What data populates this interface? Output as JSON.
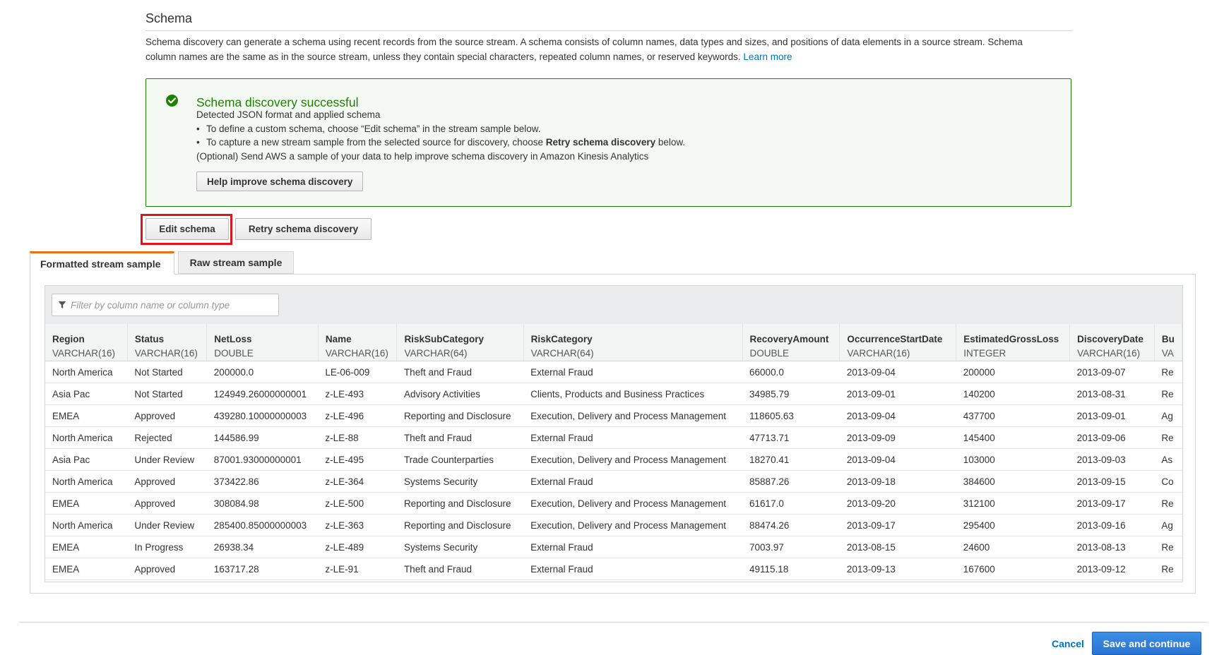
{
  "schema": {
    "title": "Schema",
    "description_1": "Schema discovery can generate a schema using recent records from the source stream. A schema consists of column names, data types and sizes, and positions of data elements in a source stream. Schema",
    "description_2": "column names are the same as in the source stream, unless they contain special characters, repeated column names, or reserved keywords.",
    "learn_more": "Learn more"
  },
  "success": {
    "title": "Schema discovery successful",
    "detected": "Detected JSON format and applied schema",
    "bullet_1": "To define a custom schema, choose “Edit schema” in the stream sample below.",
    "bullet_2_prefix": "To capture a new stream sample from the selected source for discovery, choose",
    "bullet_2_bold": "Retry schema discovery",
    "bullet_2_suffix": "below.",
    "optional": "(Optional) Send AWS a sample of your data to help improve schema discovery in Amazon Kinesis Analytics",
    "help_button": "Help improve schema discovery"
  },
  "actions": {
    "edit_schema": "Edit schema",
    "retry": "Retry schema discovery"
  },
  "tabs": [
    {
      "label": "Formatted stream sample",
      "active": true
    },
    {
      "label": "Raw stream sample",
      "active": false
    }
  ],
  "filter": {
    "placeholder": "Filter by column name or column type"
  },
  "columns": [
    {
      "name": "Region",
      "type": "VARCHAR(16)"
    },
    {
      "name": "Status",
      "type": "VARCHAR(16)"
    },
    {
      "name": "NetLoss",
      "type": "DOUBLE"
    },
    {
      "name": "Name",
      "type": "VARCHAR(16)"
    },
    {
      "name": "RiskSubCategory",
      "type": "VARCHAR(64)"
    },
    {
      "name": "RiskCategory",
      "type": "VARCHAR(64)"
    },
    {
      "name": "RecoveryAmount",
      "type": "DOUBLE"
    },
    {
      "name": "OccurrenceStartDate",
      "type": "VARCHAR(16)"
    },
    {
      "name": "EstimatedGrossLoss",
      "type": "INTEGER"
    },
    {
      "name": "DiscoveryDate",
      "type": "VARCHAR(16)"
    },
    {
      "name": "Bu",
      "type": "VA"
    }
  ],
  "rows": [
    [
      "North America",
      "Not Started",
      "200000.0",
      "LE-06-009",
      "Theft and Fraud",
      "External Fraud",
      "66000.0",
      "2013-09-04",
      "200000",
      "2013-09-07",
      "Re"
    ],
    [
      "Asia Pac",
      "Not Started",
      "124949.26000000001",
      "z-LE-493",
      "Advisory Activities",
      "Clients, Products and Business Practices",
      "34985.79",
      "2013-09-01",
      "140200",
      "2013-08-31",
      "Re"
    ],
    [
      "EMEA",
      "Approved",
      "439280.10000000003",
      "z-LE-496",
      "Reporting and Disclosure",
      "Execution, Delivery and Process Management",
      "118605.63",
      "2013-09-04",
      "437700",
      "2013-09-01",
      "Ag"
    ],
    [
      "North America",
      "Rejected",
      "144586.99",
      "z-LE-88",
      "Theft and Fraud",
      "External Fraud",
      "47713.71",
      "2013-09-09",
      "145400",
      "2013-09-06",
      "Re"
    ],
    [
      "Asia Pac",
      "Under Review",
      "87001.93000000001",
      "z-LE-495",
      "Trade Counterparties",
      "Execution, Delivery and Process Management",
      "18270.41",
      "2013-09-04",
      "103000",
      "2013-09-03",
      "As"
    ],
    [
      "North America",
      "Approved",
      "373422.86",
      "z-LE-364",
      "Systems Security",
      "External Fraud",
      "85887.26",
      "2013-09-18",
      "384600",
      "2013-09-15",
      "Co"
    ],
    [
      "EMEA",
      "Approved",
      "308084.98",
      "z-LE-500",
      "Reporting and Disclosure",
      "Execution, Delivery and Process Management",
      "61617.0",
      "2013-09-20",
      "312100",
      "2013-09-17",
      "Re"
    ],
    [
      "North America",
      "Under Review",
      "285400.85000000003",
      "z-LE-363",
      "Reporting and Disclosure",
      "Execution, Delivery and Process Management",
      "88474.26",
      "2013-09-17",
      "295400",
      "2013-09-16",
      "Ag"
    ],
    [
      "EMEA",
      "In Progress",
      "26938.34",
      "z-LE-489",
      "Systems Security",
      "External Fraud",
      "7003.97",
      "2013-08-15",
      "24600",
      "2013-08-13",
      "Re"
    ],
    [
      "EMEA",
      "Approved",
      "163717.28",
      "z-LE-91",
      "Theft and Fraud",
      "External Fraud",
      "49115.18",
      "2013-09-13",
      "167600",
      "2013-09-12",
      "Re"
    ]
  ],
  "footer": {
    "cancel": "Cancel",
    "save": "Save and continue"
  },
  "colors": {
    "success_green": "#1d8102",
    "link_blue": "#0073bb",
    "highlight_red": "#e0141c",
    "tab_orange": "#ec7211"
  }
}
